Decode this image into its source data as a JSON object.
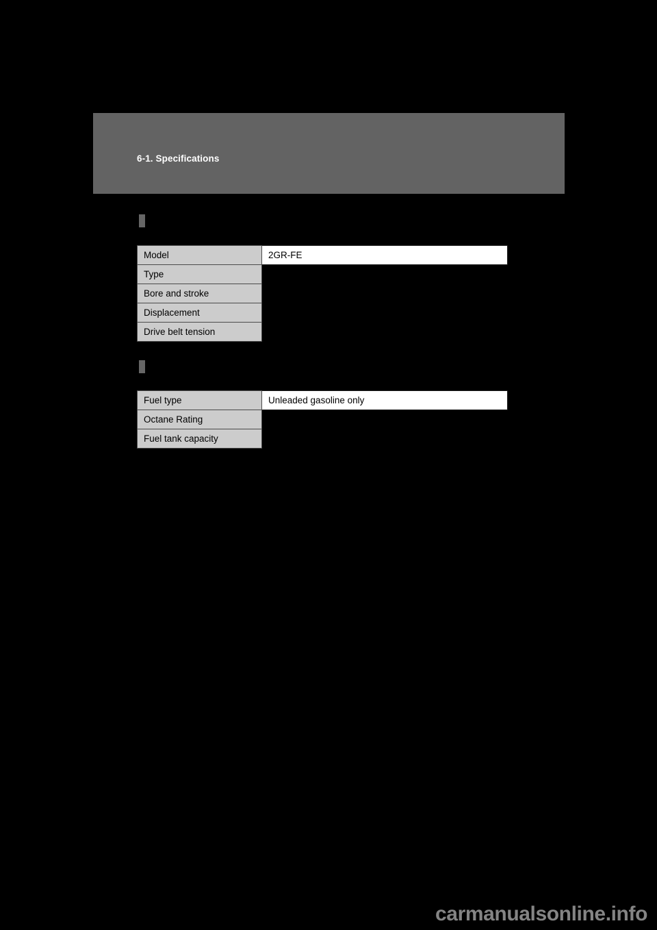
{
  "header": {
    "title": "6-1. Specifications",
    "banner_color": "#636363"
  },
  "sections": [
    {
      "marker": "section-bullet",
      "table": {
        "rows": [
          {
            "label": "Model",
            "value": "2GR-FE",
            "has_value": true
          },
          {
            "label": "Type",
            "value": "",
            "has_value": false
          },
          {
            "label": "Bore and stroke",
            "value": "",
            "has_value": false
          },
          {
            "label": "Displacement",
            "value": "",
            "has_value": false
          },
          {
            "label": "Drive belt tension",
            "value": "",
            "has_value": false
          }
        ]
      }
    },
    {
      "marker": "section-bullet",
      "table": {
        "rows": [
          {
            "label": "Fuel type",
            "value": "Unleaded gasoline only",
            "has_value": true
          },
          {
            "label": "Octane Rating",
            "value": "",
            "has_value": false
          },
          {
            "label": "Fuel tank capacity",
            "value": "",
            "has_value": false
          }
        ]
      }
    }
  ],
  "watermark": {
    "text": "carmanualsonline.info",
    "color": "#848484"
  },
  "colors": {
    "page_background": "#000000",
    "label_cell": "#cccccc",
    "value_cell": "#ffffff",
    "banner": "#636363",
    "marker": "#666666"
  }
}
